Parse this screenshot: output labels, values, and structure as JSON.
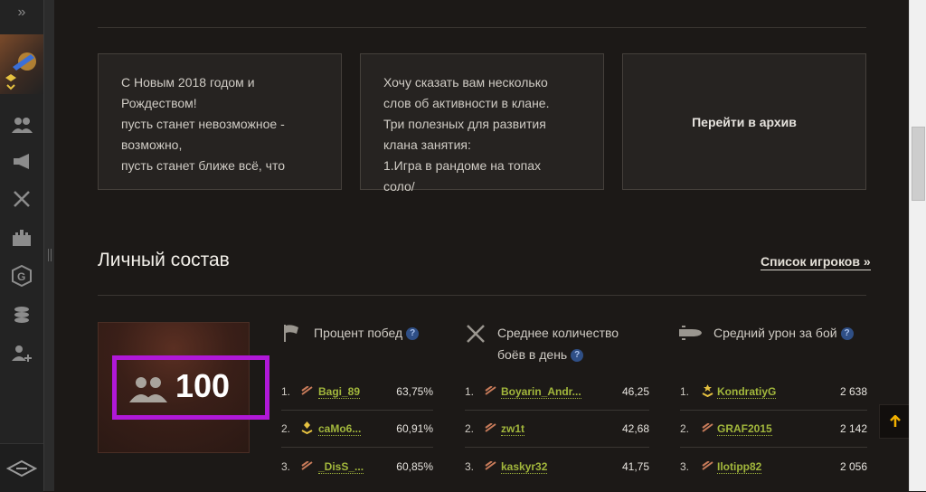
{
  "sidebar": {
    "expand_label": "»",
    "items": [
      {
        "icon": "members-icon"
      },
      {
        "icon": "megaphone-icon"
      },
      {
        "icon": "crossed-swords-icon"
      },
      {
        "icon": "fortress-icon"
      },
      {
        "icon": "global-map-icon"
      },
      {
        "icon": "coins-icon"
      },
      {
        "icon": "add-member-icon"
      }
    ],
    "bottom_icon": "wot-logo-icon"
  },
  "news": [
    {
      "text": "С Новым 2018 годом и\nРождеством!\nпусть станет невозможное -\nвозможно,\nпусть станет ближе всё, что"
    },
    {
      "text": "Хочу сказать вам несколько\nслов об активности в клане.\nТри полезных для развития\nклана занятия:\n1.Игра в рандоме на топах соло/"
    }
  ],
  "archive_label": "Перейти в архив",
  "personnel": {
    "title": "Личный состав",
    "players_link": "Список игроков »",
    "member_count": "100",
    "help_glyph": "?",
    "columns": [
      {
        "icon": "flag-icon",
        "title": "Процент побед",
        "rows": [
          {
            "idx": "1.",
            "name": "Bagi_89",
            "value": "63,75%"
          },
          {
            "idx": "2.",
            "name": "caMo6...",
            "value": "60,91%"
          },
          {
            "idx": "3.",
            "name": "_DisS_...",
            "value": "60,85%"
          }
        ]
      },
      {
        "icon": "crossed-swords-icon",
        "title_line1": "Среднее количество",
        "title_line2": "боёв в день",
        "rows": [
          {
            "idx": "1.",
            "name": "Boyarin_Andr...",
            "value": "46,25"
          },
          {
            "idx": "2.",
            "name": "zw1t",
            "value": "42,68"
          },
          {
            "idx": "3.",
            "name": "kaskyr32",
            "value": "41,75"
          }
        ]
      },
      {
        "icon": "shell-icon",
        "title": "Средний урон за бой",
        "rows": [
          {
            "idx": "1.",
            "name": "KondratiyG",
            "value": "2 638"
          },
          {
            "idx": "2.",
            "name": "GRAF2015",
            "value": "2 142"
          },
          {
            "idx": "3.",
            "name": "Ilotipp82",
            "value": "2 056"
          }
        ]
      }
    ]
  },
  "colors": {
    "accent": "#a2b73c",
    "highlight": "#b018d8",
    "up_arrow": "#f2b000"
  },
  "up_button_icon": "arrow-up-icon"
}
